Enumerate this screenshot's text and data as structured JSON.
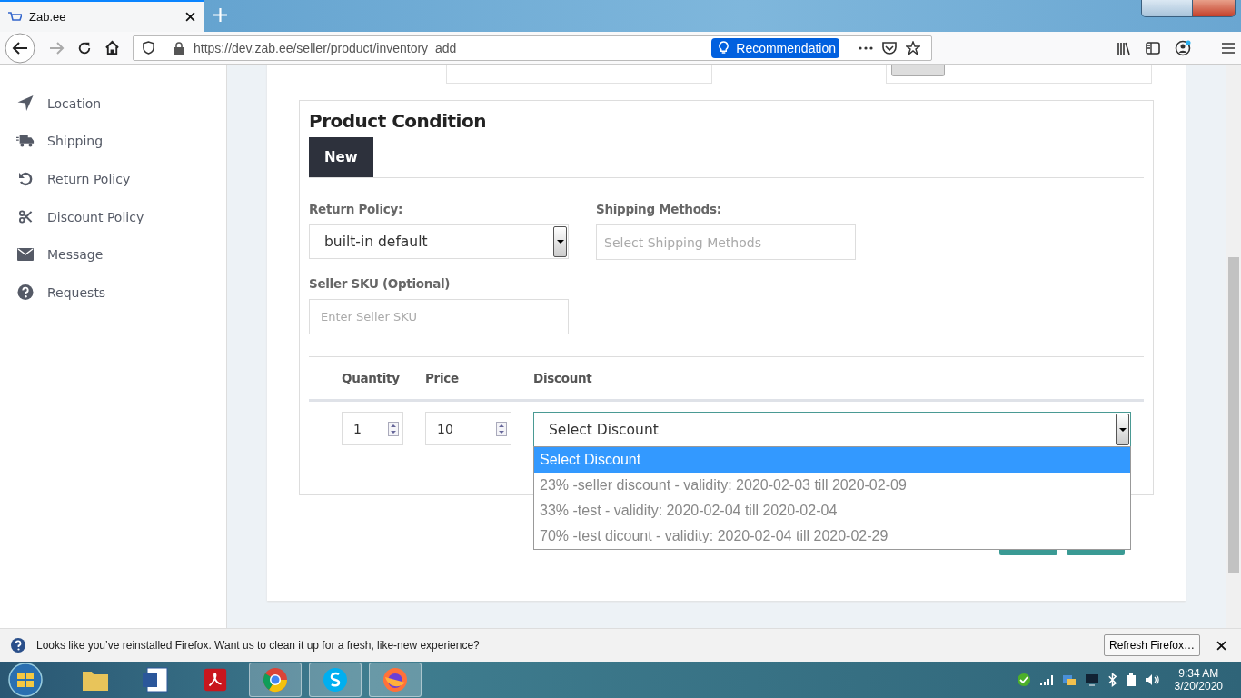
{
  "browser": {
    "tab_title": "Zab.ee",
    "url": "https://dev.zab.ee/seller/product/inventory_add",
    "recommendation": "Recommendation"
  },
  "sidebar": {
    "items": [
      {
        "label": "Location"
      },
      {
        "label": "Shipping"
      },
      {
        "label": "Return Policy"
      },
      {
        "label": "Discount Policy"
      },
      {
        "label": "Message"
      },
      {
        "label": "Requests"
      }
    ]
  },
  "form": {
    "heading": "Product Condition",
    "tabs": [
      {
        "label": "New",
        "selected": true
      }
    ],
    "return_policy": {
      "label": "Return Policy:",
      "value": "built-in default"
    },
    "shipping_methods": {
      "label": "Shipping Methods:",
      "placeholder": "Select Shipping Methods"
    },
    "seller_sku": {
      "label": "Seller SKU (Optional)",
      "placeholder": "Enter Seller SKU"
    },
    "table": {
      "columns": [
        "Quantity",
        "Price",
        "Discount"
      ],
      "row": {
        "quantity": "1",
        "price": "10",
        "discount": "Select Discount"
      }
    },
    "discount_options": [
      {
        "label": "Select Discount",
        "selected": true
      },
      {
        "label": "23% -seller discount - validity: 2020-02-03 till 2020-02-09",
        "selected": false
      },
      {
        "label": "33% -test - validity: 2020-02-04 till 2020-02-04",
        "selected": false
      },
      {
        "label": "70% -test dicount - validity: 2020-02-04 till 2020-02-29",
        "selected": false
      }
    ]
  },
  "notification": {
    "message": "Looks like you’ve reinstalled Firefox. Want us to clean it up for a fresh, like-new experience?",
    "button": "Refresh Firefox…"
  },
  "taskbar": {
    "time": "9:34 AM",
    "date": "3/20/2020"
  }
}
